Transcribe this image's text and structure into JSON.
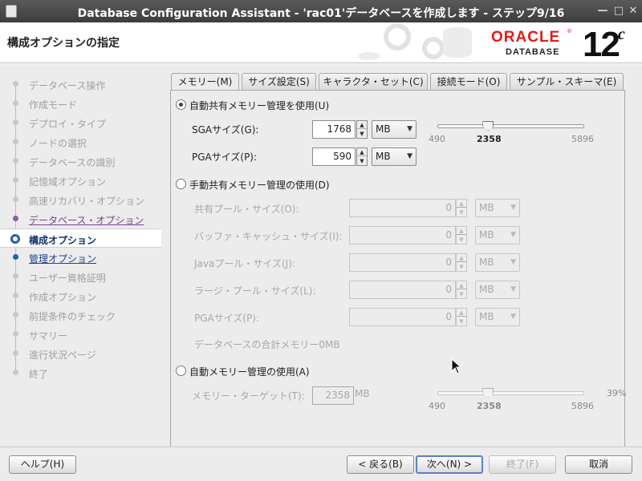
{
  "window": {
    "title": "Database Configuration Assistant - 'rac01'データベースを作成します - ステップ9/16"
  },
  "header": {
    "title": "構成オプションの指定",
    "logo_oracle": "ORACLE",
    "logo_reg": "®",
    "logo_database": "DATABASE",
    "logo_version": "12",
    "logo_version_sup": "c"
  },
  "nav": {
    "items": [
      {
        "label": "データベース操作",
        "state": "disabled"
      },
      {
        "label": "作成モード",
        "state": "disabled"
      },
      {
        "label": "デプロイ・タイプ",
        "state": "disabled"
      },
      {
        "label": "ノードの選択",
        "state": "disabled"
      },
      {
        "label": "データベースの識別",
        "state": "disabled"
      },
      {
        "label": "記憶域オプション",
        "state": "disabled"
      },
      {
        "label": "高速リカバリ・オプション",
        "state": "disabled"
      },
      {
        "label": "データベース・オプション",
        "state": "visited"
      },
      {
        "label": "構成オプション",
        "state": "current"
      },
      {
        "label": "管理オプション",
        "state": "next"
      },
      {
        "label": "ユーザー資格証明",
        "state": "disabled"
      },
      {
        "label": "作成オプション",
        "state": "disabled"
      },
      {
        "label": "前提条件のチェック",
        "state": "disabled"
      },
      {
        "label": "サマリー",
        "state": "disabled"
      },
      {
        "label": "進行状況ページ",
        "state": "disabled"
      },
      {
        "label": "終了",
        "state": "disabled"
      }
    ]
  },
  "tabs": [
    "メモリー(M)",
    "サイズ設定(S)",
    "キャラクタ・セット(C)",
    "接続モード(O)",
    "サンプル・スキーマ(E)"
  ],
  "memory": {
    "auto_shared": {
      "label": "自動共有メモリー管理を使用(U)",
      "selected": true,
      "sga_label": "SGAサイズ(G):",
      "sga_value": "1768",
      "sga_unit": "MB",
      "pga_label": "PGAサイズ(P):",
      "pga_value": "590",
      "pga_unit": "MB",
      "slider": {
        "min": "490",
        "max": "5896",
        "value": "2358",
        "fraction": 0.346
      }
    },
    "manual_shared": {
      "label": "手動共有メモリー管理の使用(D)",
      "selected": false,
      "fields": [
        {
          "label": "共有プール・サイズ(O):",
          "value": "0",
          "unit": "MB"
        },
        {
          "label": "バッファ・キャッシュ・サイズ(I):",
          "value": "0",
          "unit": "MB"
        },
        {
          "label": "Javaプール・サイズ(J):",
          "value": "0",
          "unit": "MB"
        },
        {
          "label": "ラージ・プール・サイズ(L):",
          "value": "0",
          "unit": "MB"
        },
        {
          "label": "PGAサイズ(P):",
          "value": "0",
          "unit": "MB"
        }
      ],
      "total_label": "データベースの合計メモリー0MB"
    },
    "auto_memory": {
      "label": "自動メモリー管理の使用(A)",
      "selected": false,
      "target_label": "メモリー・ターゲット(T):",
      "target_value": "2358",
      "target_unit": "MB",
      "percent": "39%",
      "slider": {
        "min": "490",
        "max": "5896",
        "value": "2358",
        "fraction": 0.346
      }
    }
  },
  "buttons": {
    "help": "ヘルプ(H)",
    "back": "< 戻る(B)",
    "next": "次へ(N) >",
    "finish": "終了(F)",
    "cancel": "取消"
  },
  "colors": {
    "accent": "#2b5fa7",
    "visited": "#7b3f98",
    "oracle_red": "#e41b17"
  }
}
